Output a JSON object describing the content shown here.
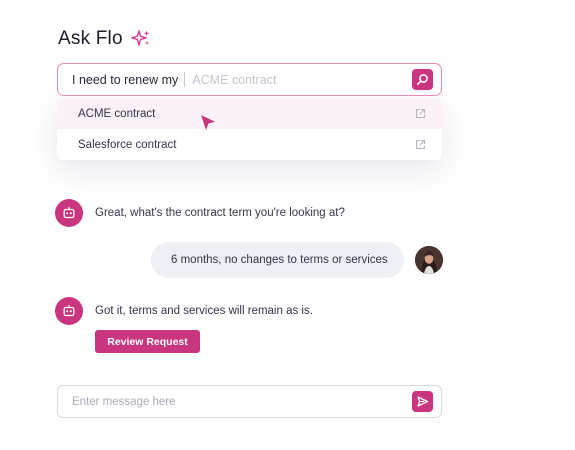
{
  "header": {
    "title": "Ask Flo",
    "icon": "sparkle-icon"
  },
  "search": {
    "typed_text": "I need to renew my",
    "suggestion": "ACME contract",
    "button_icon": "search-icon"
  },
  "dropdown": {
    "items": [
      {
        "label": "ACME contract",
        "icon": "external-link-icon"
      },
      {
        "label": "Salesforce contract",
        "icon": "external-link-icon"
      }
    ]
  },
  "chat": {
    "messages": [
      {
        "from": "bot",
        "text": "Great, what's the contract term you're looking at?"
      },
      {
        "from": "user",
        "text": "6 months, no changes to terms or services"
      },
      {
        "from": "bot",
        "text": "Got it, terms and services will remain as is."
      }
    ],
    "review_button": "Review Request"
  },
  "composer": {
    "placeholder": "Enter message here",
    "send_icon": "send-icon"
  },
  "colors": {
    "accent": "#c9357f",
    "highlight": "#fbf1f8",
    "bubble": "#eef0f5"
  }
}
